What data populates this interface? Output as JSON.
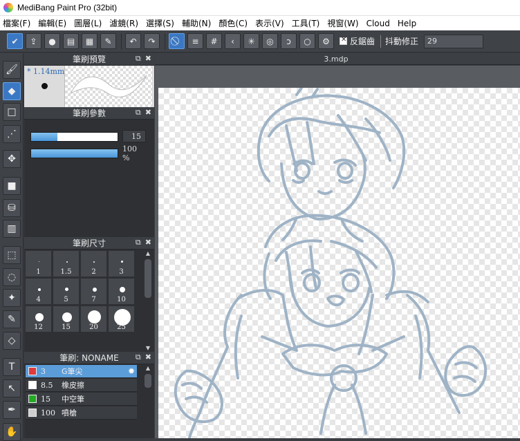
{
  "window": {
    "title": "MediBang Paint Pro (32bit)"
  },
  "menu": [
    "檔案(F)",
    "編輯(E)",
    "圖層(L)",
    "濾鏡(R)",
    "選擇(S)",
    "輔助(N)",
    "顏色(C)",
    "表示(V)",
    "工具(T)",
    "視窗(W)",
    "Cloud",
    "Help"
  ],
  "toolbar": {
    "buttons": [
      "check-icon",
      "share-icon",
      "comment-icon",
      "balloon-icon",
      "list-icon",
      "edit-icon",
      "undo-icon",
      "redo-icon",
      "snap-off-icon",
      "parallel-snap-icon",
      "grid-snap-icon",
      "perspective-icon",
      "radial-icon",
      "concentric-icon",
      "curve-icon",
      "circle-snap-icon",
      "settings-icon"
    ],
    "antialias_label": "反鋸齒",
    "antialias_checked": true,
    "stabilizer_label": "抖動修正",
    "stabilizer_value": "29"
  },
  "tools": [
    "brush-icon",
    "eraser-icon",
    "dot-icon",
    "dotted-line-icon",
    "move-icon",
    "rectangle-fill-icon",
    "bucket-icon",
    "gradient-icon",
    "rect-select-icon",
    "lasso-icon",
    "magic-wand-icon",
    "select-pen-icon",
    "select-eraser-icon",
    "text-icon",
    "operation-icon",
    "eyedropper-icon",
    "hand-icon"
  ],
  "active_tool": 1,
  "panels": {
    "preview": {
      "title": "筆刷預覽",
      "size_label": "* 1.14mm"
    },
    "params": {
      "title": "筆刷參數",
      "width_value": "15",
      "width_fill": 0.3,
      "opacity_value": "100 %",
      "opacity_fill": 1.0
    },
    "sizes": {
      "title": "筆刷尺寸",
      "items": [
        "1",
        "1.5",
        "2",
        "3",
        "4",
        "5",
        "7",
        "10",
        "12",
        "15",
        "20",
        "25"
      ]
    },
    "brushes": {
      "title": "筆刷: NONAME",
      "items": [
        {
          "color": "#e03a3a",
          "size": "3",
          "name": "G筆尖",
          "selected": true
        },
        {
          "color": "#ffffff",
          "size": "8.5",
          "name": "橡皮擦",
          "selected": false
        },
        {
          "color": "#22aa22",
          "size": "15",
          "name": "中空筆",
          "selected": false
        },
        {
          "color": "#d0d0d0",
          "size": "100",
          "name": "噴槍",
          "selected": false
        }
      ]
    }
  },
  "document": {
    "tab_label": "3.mdp"
  },
  "colors": {
    "accent": "#3b78c4",
    "panel": "#2e3034",
    "sketch_line": "#9fb3c6"
  }
}
